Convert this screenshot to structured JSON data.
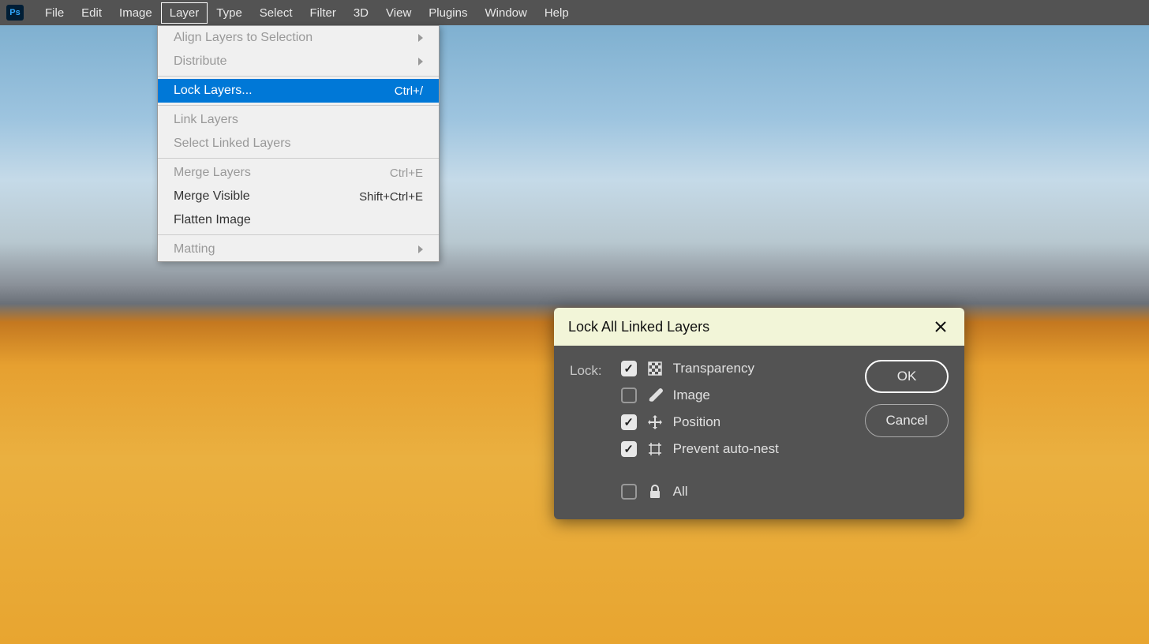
{
  "menubar": {
    "items": [
      "File",
      "Edit",
      "Image",
      "Layer",
      "Type",
      "Select",
      "Filter",
      "3D",
      "View",
      "Plugins",
      "Window",
      "Help"
    ],
    "activeIndex": 3
  },
  "dropdown": {
    "items": [
      {
        "label": "Align Layers to Selection",
        "shortcut": "",
        "submenu": true,
        "disabled": true
      },
      {
        "label": "Distribute",
        "shortcut": "",
        "submenu": true,
        "disabled": true
      },
      {
        "sep": true
      },
      {
        "label": "Lock Layers...",
        "shortcut": "Ctrl+/",
        "highlighted": true
      },
      {
        "sep": true
      },
      {
        "label": "Link Layers",
        "shortcut": "",
        "disabled": true
      },
      {
        "label": "Select Linked Layers",
        "shortcut": "",
        "disabled": true
      },
      {
        "sep": true
      },
      {
        "label": "Merge Layers",
        "shortcut": "Ctrl+E",
        "disabled": true
      },
      {
        "label": "Merge Visible",
        "shortcut": "Shift+Ctrl+E"
      },
      {
        "label": "Flatten Image",
        "shortcut": ""
      },
      {
        "sep": true
      },
      {
        "label": "Matting",
        "shortcut": "",
        "submenu": true,
        "disabled": true
      }
    ]
  },
  "dialog": {
    "title": "Lock All Linked Layers",
    "lockLabel": "Lock:",
    "options": [
      {
        "label": "Transparency",
        "checked": true,
        "icon": "transparency"
      },
      {
        "label": "Image",
        "checked": false,
        "icon": "brush"
      },
      {
        "label": "Position",
        "checked": true,
        "icon": "move"
      },
      {
        "label": "Prevent auto-nest",
        "checked": true,
        "icon": "artboard"
      },
      {
        "label": "All",
        "checked": false,
        "icon": "lock",
        "spaced": true
      }
    ],
    "buttons": {
      "ok": "OK",
      "cancel": "Cancel"
    }
  }
}
